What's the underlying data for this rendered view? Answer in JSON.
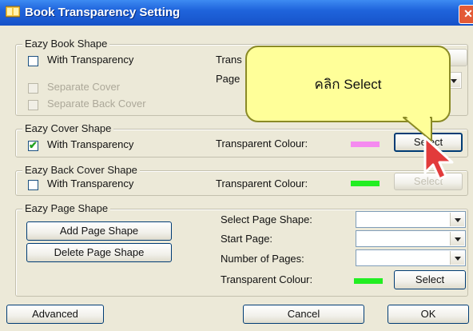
{
  "window": {
    "title": "Book Transparency Setting",
    "close_glyph": "✕"
  },
  "book_shape": {
    "legend": "Eazy Book Shape",
    "with_transparency": "With Transparency",
    "separate_cover": "Separate Cover",
    "separate_back_cover": "Separate Back Cover",
    "transparent_label_partial": "Trans",
    "page_label_partial": "Page"
  },
  "cover_shape": {
    "legend": "Eazy Cover Shape",
    "with_transparency": "With Transparency",
    "checked": true,
    "transparent_colour_label": "Transparent Colour:",
    "colour": "#f58af0",
    "select_label": "Select"
  },
  "back_cover_shape": {
    "legend": "Eazy Back Cover Shape",
    "with_transparency": "With Transparency",
    "checked": false,
    "transparent_colour_label": "Transparent Colour:",
    "colour": "#22ee22",
    "select_label": "Select"
  },
  "page_shape": {
    "legend": "Eazy Page Shape",
    "add_button": "Add Page Shape",
    "delete_button": "Delete Page Shape",
    "select_page_shape_label": "Select Page Shape:",
    "start_page_label": "Start Page:",
    "number_of_pages_label": "Number of Pages:",
    "transparent_colour_label": "Transparent Colour:",
    "colour": "#22ee22",
    "select_label": "Select"
  },
  "footer": {
    "advanced": "Advanced",
    "cancel": "Cancel",
    "ok": "OK"
  },
  "callout": {
    "text": "คลิก Select"
  }
}
